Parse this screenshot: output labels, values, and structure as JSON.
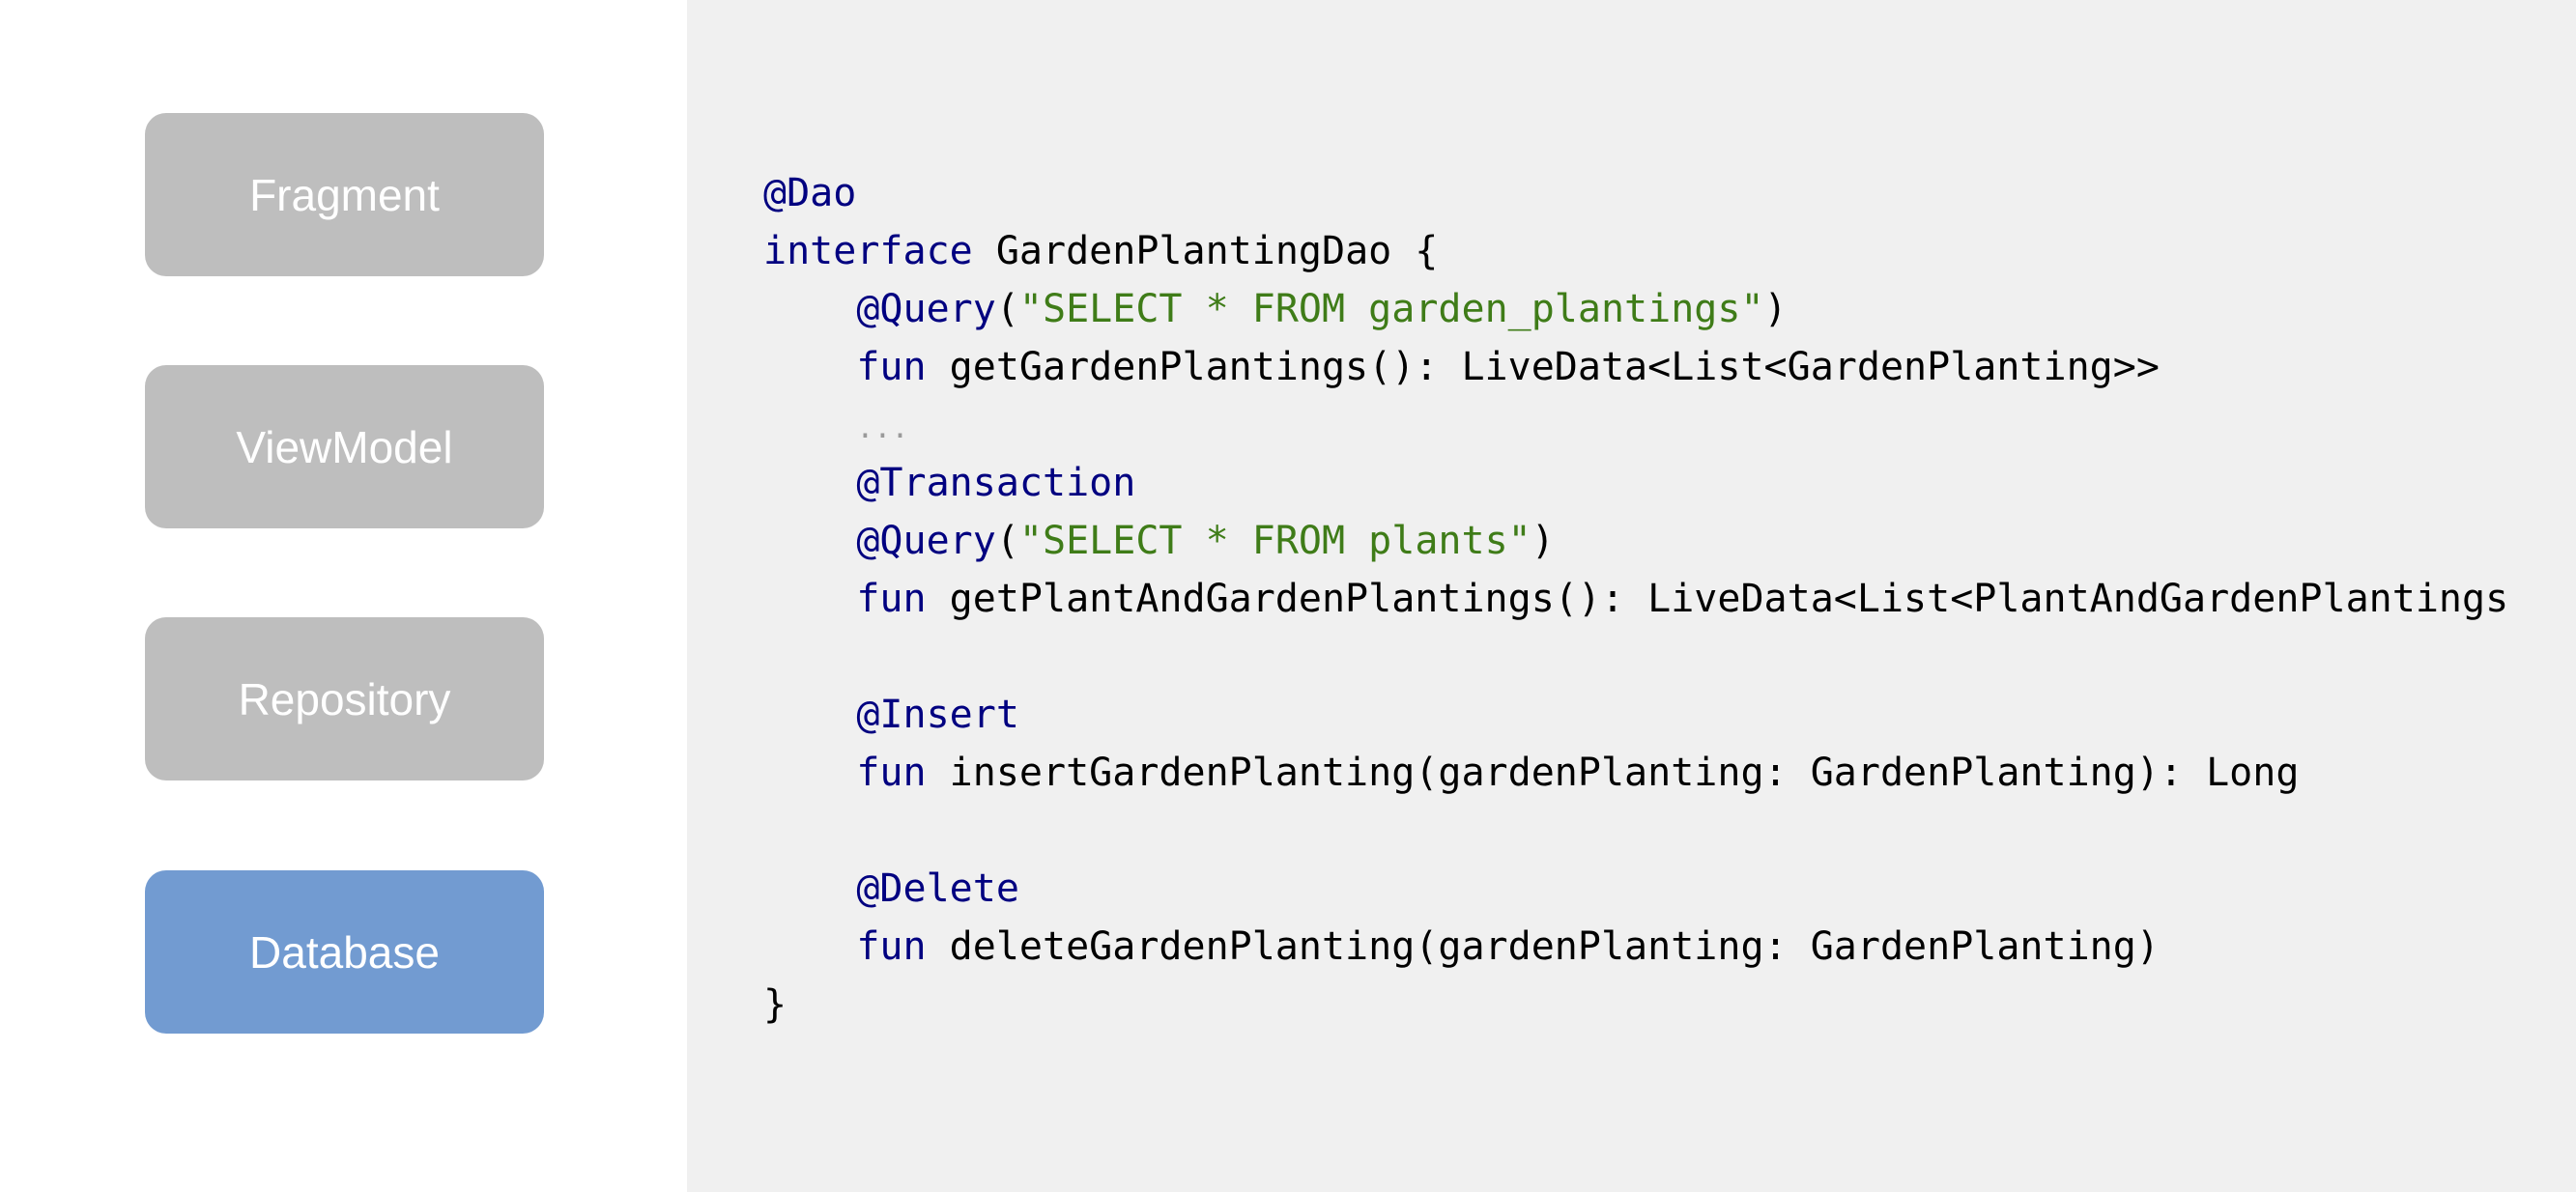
{
  "layers": [
    {
      "label": "Fragment",
      "active": false
    },
    {
      "label": "ViewModel",
      "active": false
    },
    {
      "label": "Repository",
      "active": false
    },
    {
      "label": "Database",
      "active": true
    }
  ],
  "colors": {
    "inactive_box": "#bebebe",
    "active_box": "#729bd1",
    "code_background": "#f0f0f0",
    "keyword": "#000080",
    "string": "#3f7c18",
    "comment": "#9a9a9a"
  },
  "code": {
    "language": "kotlin",
    "lines": [
      [
        [
          "ann",
          "@Dao"
        ]
      ],
      [
        [
          "kw",
          "interface"
        ],
        [
          "txt",
          " GardenPlantingDao {"
        ]
      ],
      [
        [
          "txt",
          "    "
        ],
        [
          "ann",
          "@Query"
        ],
        [
          "txt",
          "("
        ],
        [
          "str",
          "\"SELECT * FROM garden_plantings\""
        ],
        [
          "txt",
          ")"
        ]
      ],
      [
        [
          "txt",
          "    "
        ],
        [
          "kw",
          "fun"
        ],
        [
          "txt",
          " getGardenPlantings(): LiveData<List<GardenPlanting>>"
        ]
      ],
      [
        [
          "txt",
          "    "
        ],
        [
          "cmt",
          "..."
        ]
      ],
      [
        [
          "txt",
          "    "
        ],
        [
          "ann",
          "@Transaction"
        ]
      ],
      [
        [
          "txt",
          "    "
        ],
        [
          "ann",
          "@Query"
        ],
        [
          "txt",
          "("
        ],
        [
          "str",
          "\"SELECT * FROM plants\""
        ],
        [
          "txt",
          ")"
        ]
      ],
      [
        [
          "txt",
          "    "
        ],
        [
          "kw",
          "fun"
        ],
        [
          "txt",
          " getPlantAndGardenPlantings(): LiveData<List<PlantAndGardenPlantings"
        ]
      ],
      [
        [
          "txt",
          ""
        ]
      ],
      [
        [
          "txt",
          "    "
        ],
        [
          "ann",
          "@Insert"
        ]
      ],
      [
        [
          "txt",
          "    "
        ],
        [
          "kw",
          "fun"
        ],
        [
          "txt",
          " insertGardenPlanting(gardenPlanting: GardenPlanting): Long"
        ]
      ],
      [
        [
          "txt",
          ""
        ]
      ],
      [
        [
          "txt",
          "    "
        ],
        [
          "ann",
          "@Delete"
        ]
      ],
      [
        [
          "txt",
          "    "
        ],
        [
          "kw",
          "fun"
        ],
        [
          "txt",
          " deleteGardenPlanting(gardenPlanting: GardenPlanting)"
        ]
      ],
      [
        [
          "txt",
          "}"
        ]
      ]
    ]
  }
}
